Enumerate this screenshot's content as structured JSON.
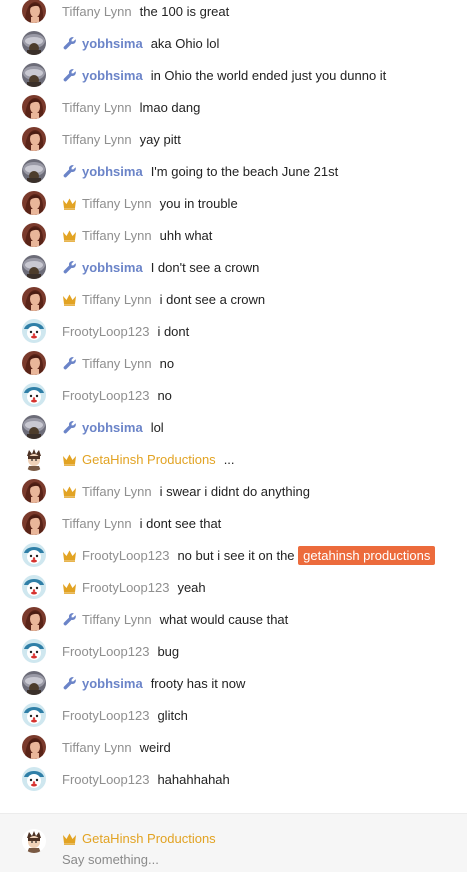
{
  "colors": {
    "mod": "#6b84c8",
    "owner": "#e2a323",
    "mention": "#ec6b3c"
  },
  "icons": {
    "mod": "wrench-icon",
    "owner": "crown-icon"
  },
  "messages": [
    {
      "user": "Tiffany Lynn",
      "avatar": "tiffany",
      "badge": "none",
      "text": "the 100 is great"
    },
    {
      "user": "yobhsima",
      "avatar": "yobhsima",
      "badge": "mod",
      "text": "aka Ohio lol"
    },
    {
      "user": "yobhsima",
      "avatar": "yobhsima",
      "badge": "mod",
      "text": "in Ohio the world ended just you dunno it"
    },
    {
      "user": "Tiffany Lynn",
      "avatar": "tiffany",
      "badge": "none",
      "text": "lmao dang"
    },
    {
      "user": "Tiffany Lynn",
      "avatar": "tiffany",
      "badge": "none",
      "text": "yay pitt"
    },
    {
      "user": "yobhsima",
      "avatar": "yobhsima",
      "badge": "mod",
      "text": "I'm going to the beach June 21st"
    },
    {
      "user": "Tiffany Lynn",
      "avatar": "tiffany",
      "badge": "owner",
      "text": "you in trouble"
    },
    {
      "user": "Tiffany Lynn",
      "avatar": "tiffany",
      "badge": "owner",
      "text": "uhh what"
    },
    {
      "user": "yobhsima",
      "avatar": "yobhsima",
      "badge": "mod",
      "text": "I don't see a crown"
    },
    {
      "user": "Tiffany Lynn",
      "avatar": "tiffany",
      "badge": "owner",
      "text": "i dont see a crown"
    },
    {
      "user": "FrootyLoop123",
      "avatar": "frooty",
      "badge": "none",
      "text": "i dont"
    },
    {
      "user": "Tiffany Lynn",
      "avatar": "tiffany",
      "badge": "mod",
      "text": "no"
    },
    {
      "user": "FrootyLoop123",
      "avatar": "frooty",
      "badge": "none",
      "text": "no"
    },
    {
      "user": "yobhsima",
      "avatar": "yobhsima",
      "badge": "mod",
      "text": "lol"
    },
    {
      "user": "GetaHinsh Productions",
      "avatar": "getahinsh",
      "badge": "owner",
      "text": "..."
    },
    {
      "user": "Tiffany Lynn",
      "avatar": "tiffany",
      "badge": "owner",
      "text": "i swear i didnt do anything"
    },
    {
      "user": "Tiffany Lynn",
      "avatar": "tiffany",
      "badge": "none",
      "text": "i dont see that"
    },
    {
      "user": "FrootyLoop123",
      "avatar": "frooty",
      "badge": "owner",
      "text": "no but i see it on the",
      "mention": "getahinsh productions"
    },
    {
      "user": "FrootyLoop123",
      "avatar": "frooty",
      "badge": "owner",
      "text": "yeah"
    },
    {
      "user": "Tiffany Lynn",
      "avatar": "tiffany",
      "badge": "mod",
      "text": "what would cause that"
    },
    {
      "user": "FrootyLoop123",
      "avatar": "frooty",
      "badge": "none",
      "text": "bug"
    },
    {
      "user": "yobhsima",
      "avatar": "yobhsima",
      "badge": "mod",
      "text": "frooty has it now"
    },
    {
      "user": "FrootyLoop123",
      "avatar": "frooty",
      "badge": "none",
      "text": "glitch"
    },
    {
      "user": "Tiffany Lynn",
      "avatar": "tiffany",
      "badge": "none",
      "text": "weird"
    },
    {
      "user": "FrootyLoop123",
      "avatar": "frooty",
      "badge": "none",
      "text": "hahahhahah"
    }
  ],
  "composer": {
    "user": "GetaHinsh Productions",
    "badge": "owner",
    "placeholder": "Say something..."
  }
}
